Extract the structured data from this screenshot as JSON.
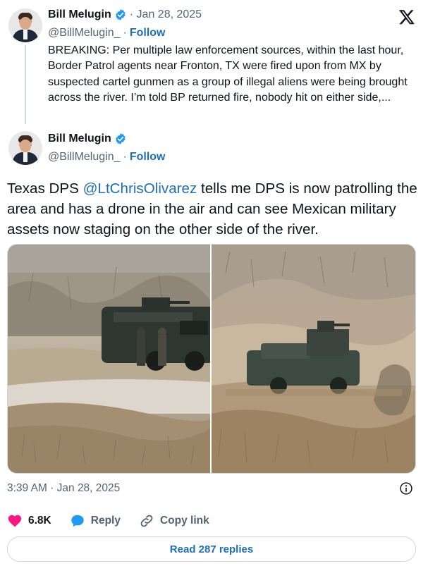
{
  "quoted_tweet": {
    "author_name": "Bill Melugin",
    "date": "· Jan 28, 2025",
    "handle": "@BillMelugin_",
    "separator": "·",
    "follow_label": "Follow",
    "text": "BREAKING: Per multiple law enforcement sources, within the last hour, Border Patrol agents near Fronton, TX were fired upon from MX by suspected cartel gunmen as a group of illegal aliens were being brought across the river. I’m told BP returned fire, nobody hit on either side,..."
  },
  "main_tweet": {
    "author_name": "Bill Melugin",
    "handle": "@BillMelugin_",
    "separator": "·",
    "follow_label": "Follow",
    "text_before": "Texas DPS ",
    "mention": "@LtChrisOlivarez",
    "text_after": " tells me DPS is now patrolling the area and has a drone in the air and can see Mexican military assets now staging on the other side of the river.",
    "timestamp": "3:39 AM · Jan 28, 2025",
    "likes": "6.8K",
    "reply_label": "Reply",
    "copy_link_label": "Copy link",
    "read_replies_label": "Read 287 replies"
  },
  "colors": {
    "link": "#1d6fb8",
    "verified": "#1d9bf0",
    "like": "#f91880",
    "secondary_text": "#536471",
    "border": "#cfd9de"
  },
  "icons": {
    "platform": "x-logo-icon",
    "verified": "verified-badge-icon",
    "info": "info-icon",
    "like": "heart-icon",
    "reply": "speech-bubble-icon",
    "copy_link": "link-icon"
  }
}
